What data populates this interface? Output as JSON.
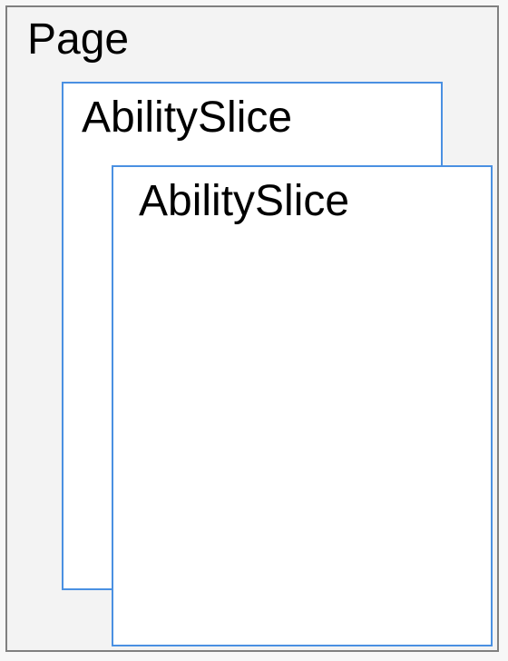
{
  "diagram": {
    "page_label": "Page",
    "slice1_label": "AbilitySlice",
    "slice2_label": "AbilitySlice"
  }
}
